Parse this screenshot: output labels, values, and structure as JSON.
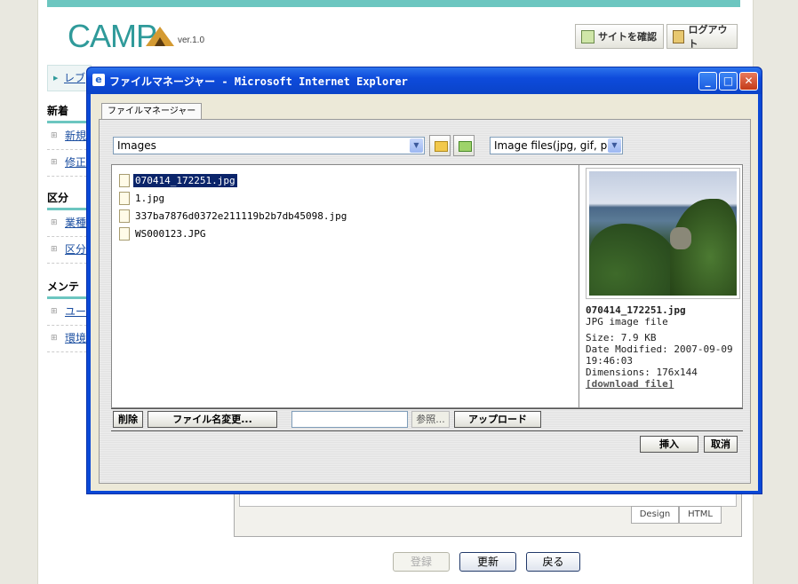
{
  "app": {
    "logo_text": "CAMP",
    "version": "ver.1.0",
    "header_buttons": [
      "サイトを確認",
      "ログアウト"
    ],
    "crumb": "レブ",
    "sidebar": {
      "section1": "新着",
      "items1": [
        "新規",
        "修正"
      ],
      "section2": "区分",
      "items2": [
        "業種",
        "区分"
      ],
      "section3": "メンテ",
      "items3": [
        "ユー",
        "環境"
      ]
    },
    "editor_modes": [
      "Design",
      "HTML"
    ],
    "bottom_buttons": [
      "登録",
      "更新",
      "戻る"
    ]
  },
  "dialog": {
    "title": "ファイルマネージャー - Microsoft Internet Explorer",
    "tab": "ファイルマネージャー",
    "folder_select": "Images",
    "filter_select": "Image files(jpg, gif, pn",
    "files": [
      "070414_172251.jpg",
      "1.jpg",
      "337ba7876d0372e211119b2b7db45098.jpg",
      "WS000123.JPG"
    ],
    "selected_index": 0,
    "preview": {
      "name": "070414_172251.jpg",
      "type": "JPG image file",
      "size": "Size: 7.9 KB",
      "modified": "Date Modified: 2007-09-09",
      "modified_time": "19:46:03",
      "dimensions": "Dimensions: 176x144",
      "download": "[download file]"
    },
    "actions": {
      "delete": "削除",
      "rename": "ファイル名変更...",
      "browse": "参照...",
      "upload": "アップロード",
      "insert": "挿入",
      "cancel": "取消"
    }
  },
  "icons": [
    "folder-up-icon",
    "new-folder-icon",
    "file-icon",
    "ie-icon",
    "minimize-icon",
    "maximize-icon",
    "close-icon"
  ]
}
